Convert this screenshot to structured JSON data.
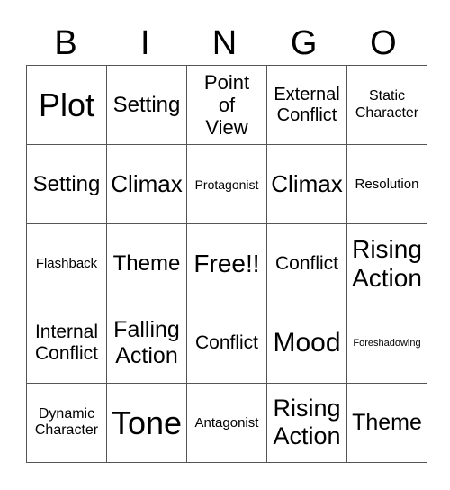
{
  "header": {
    "letters": [
      "B",
      "I",
      "N",
      "G",
      "O"
    ]
  },
  "board": {
    "rows": [
      {
        "cells": [
          {
            "text": "Plot",
            "size": "xl"
          },
          {
            "text": "Setting",
            "size": "m"
          },
          {
            "text": "Point of View",
            "size": "m"
          },
          {
            "text": "External Conflict",
            "size": "s"
          },
          {
            "text": "Static Character",
            "size": "xs"
          }
        ]
      },
      {
        "cells": [
          {
            "text": "Setting",
            "size": "m"
          },
          {
            "text": "Climax",
            "size": "l"
          },
          {
            "text": "Protagonist",
            "size": "xs"
          },
          {
            "text": "Climax",
            "size": "l"
          },
          {
            "text": "Resolution",
            "size": "xs"
          }
        ]
      },
      {
        "cells": [
          {
            "text": "Flashback",
            "size": "xs"
          },
          {
            "text": "Theme",
            "size": "m"
          },
          {
            "text": "Free!!",
            "size": "l"
          },
          {
            "text": "Conflict",
            "size": "s"
          },
          {
            "text": "Rising Action",
            "size": "l"
          }
        ]
      },
      {
        "cells": [
          {
            "text": "Internal Conflict",
            "size": "s"
          },
          {
            "text": "Falling Action",
            "size": "m"
          },
          {
            "text": "Conflict",
            "size": "s"
          },
          {
            "text": "Mood",
            "size": "l"
          },
          {
            "text": "Foreshadowing",
            "size": "xxs"
          }
        ]
      },
      {
        "cells": [
          {
            "text": "Dynamic Character",
            "size": "xs"
          },
          {
            "text": "Tone",
            "size": "xl"
          },
          {
            "text": "Antagonist",
            "size": "xs"
          },
          {
            "text": "Rising Action",
            "size": "m"
          },
          {
            "text": "Theme",
            "size": "m"
          }
        ]
      }
    ]
  }
}
